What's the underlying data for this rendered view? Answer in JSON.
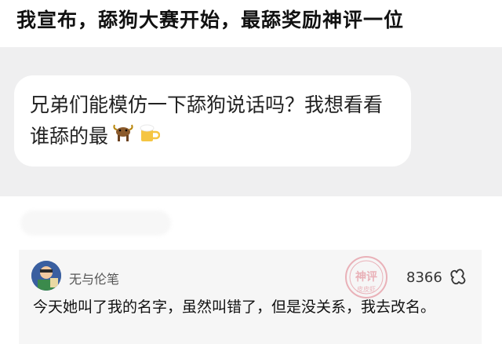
{
  "headline": "我宣布，舔狗大赛开始，最舔奖励神评一位",
  "post": {
    "text": "兄弟们能模仿一下舔狗说话吗？我想看看谁舔的最",
    "emojis": [
      "bull-emoji",
      "beer-emoji"
    ]
  },
  "comment": {
    "username": "无与伦笔",
    "likes": "8366",
    "text": "今天她叫了我的名字，虽然叫错了，但是没关系，我去改名。",
    "stamp_text": "神评",
    "stamp_subtext": "皮皮虾"
  },
  "colors": {
    "panel_bg": "#efeff0",
    "bubble_bg": "#ffffff",
    "card_bg": "#f6f6f6",
    "stamp": "#e07a86"
  }
}
